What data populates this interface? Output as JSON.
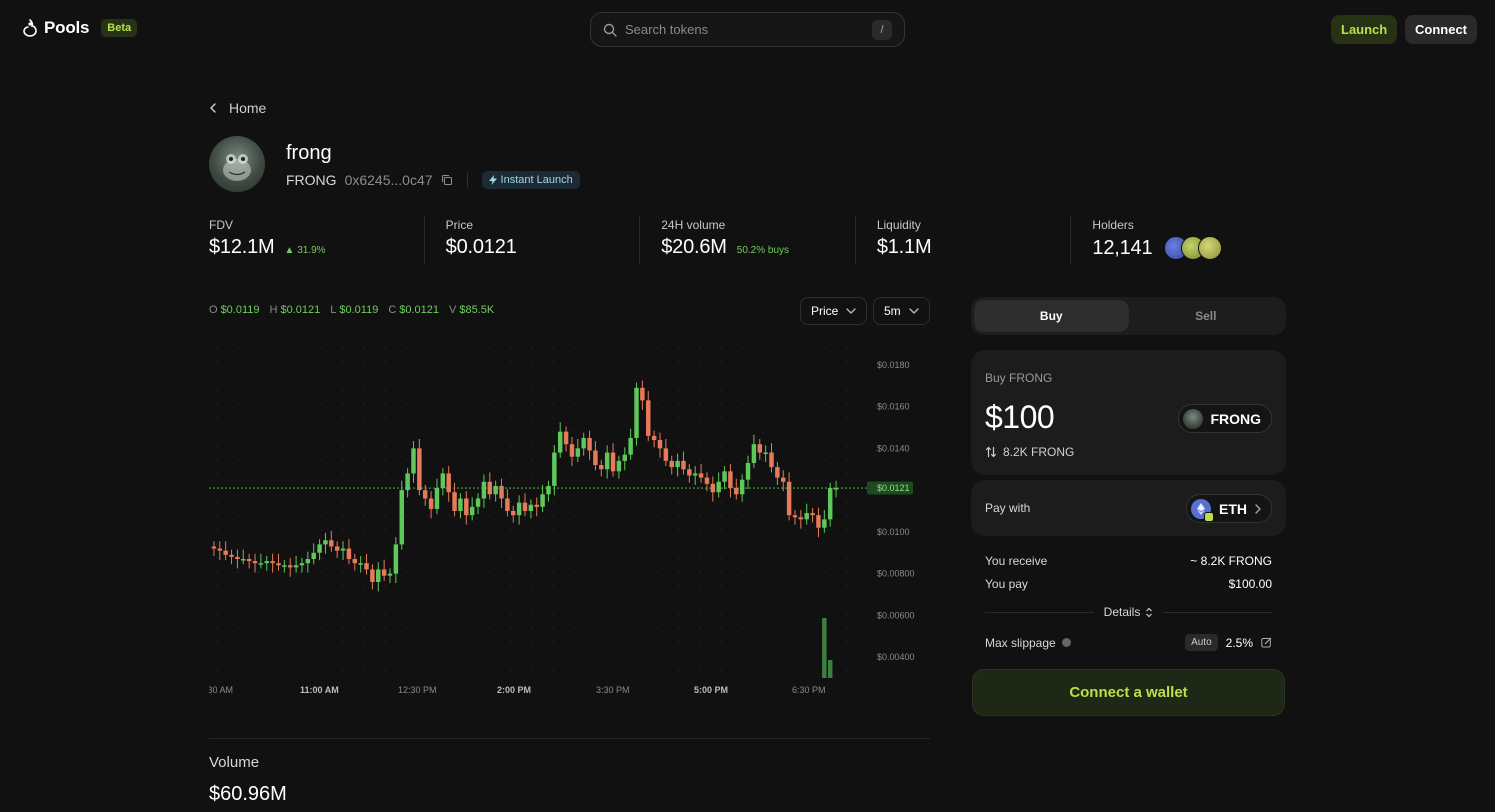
{
  "nav": {
    "logo_text": "Pools",
    "beta_label": "Beta",
    "search_placeholder": "Search tokens",
    "search_shortcut": "/",
    "launch_label": "Launch",
    "connect_label": "Connect"
  },
  "breadcrumb": {
    "back_label": "Home"
  },
  "token": {
    "name": "frong",
    "symbol": "FRONG",
    "address": "0x6245...0c47",
    "badge_label": "Instant Launch"
  },
  "stats": {
    "fdv": {
      "label": "FDV",
      "value": "$12.1M",
      "change": "31.9%"
    },
    "price": {
      "label": "Price",
      "value": "$0.0121"
    },
    "volume_24h": {
      "label": "24H volume",
      "value": "$20.6M",
      "sub": "50.2% buys"
    },
    "liquidity": {
      "label": "Liquidity",
      "value": "$1.1M"
    },
    "holders": {
      "label": "Holders",
      "value": "12,141"
    }
  },
  "ohlc": {
    "o_label": "O",
    "o": "$0.0119",
    "h_label": "H",
    "h": "$0.0121",
    "l_label": "L",
    "l": "$0.0119",
    "c_label": "C",
    "c": "$0.0121",
    "v_label": "V",
    "v": "$85.5K"
  },
  "chart_controls": {
    "type_value": "Price",
    "interval_value": "5m"
  },
  "chart_data": {
    "type": "candlestick",
    "title": "",
    "y_ticks": [
      "$0.0180",
      "$0.0160",
      "$0.0140",
      "$0.0120",
      "$0.0100",
      "$0.00800",
      "$0.00600",
      "$0.00400"
    ],
    "x_ticks": [
      ":30 AM",
      "11:00 AM",
      "12:30 PM",
      "2:00 PM",
      "3:30 PM",
      "5:00 PM",
      "6:30 PM"
    ],
    "x_ticks_bold": [
      false,
      true,
      false,
      true,
      false,
      true,
      false
    ],
    "current_price_label": "$0.0121",
    "current_price": 0.0121,
    "ylim": [
      0.003,
      0.019
    ],
    "colors": {
      "up": "#5fc85a",
      "down": "#e87a5a",
      "grid": "#2a2a2a",
      "current": "#5fc85a"
    },
    "closes": [
      0.0092,
      0.0091,
      0.0089,
      0.0088,
      0.0087,
      0.0087,
      0.0086,
      0.0085,
      0.0085,
      0.0086,
      0.0085,
      0.0084,
      0.0084,
      0.0083,
      0.0084,
      0.0085,
      0.0087,
      0.009,
      0.0094,
      0.0096,
      0.0093,
      0.0091,
      0.0092,
      0.0087,
      0.0085,
      0.0085,
      0.0082,
      0.0076,
      0.0082,
      0.0079,
      0.008,
      0.0094,
      0.012,
      0.0128,
      0.014,
      0.012,
      0.0116,
      0.0111,
      0.0121,
      0.0128,
      0.0119,
      0.011,
      0.0116,
      0.0108,
      0.0112,
      0.0116,
      0.0124,
      0.0118,
      0.0122,
      0.0116,
      0.011,
      0.0108,
      0.0114,
      0.011,
      0.0113,
      0.0112,
      0.0118,
      0.0122,
      0.0138,
      0.0148,
      0.0142,
      0.0136,
      0.014,
      0.0145,
      0.0139,
      0.0132,
      0.013,
      0.0138,
      0.0129,
      0.0134,
      0.0137,
      0.0145,
      0.0169,
      0.0163,
      0.0146,
      0.0144,
      0.014,
      0.0134,
      0.0131,
      0.0134,
      0.013,
      0.0127,
      0.0128,
      0.0126,
      0.0123,
      0.0119,
      0.0124,
      0.0129,
      0.0121,
      0.0118,
      0.0125,
      0.0133,
      0.0142,
      0.0138,
      0.0138,
      0.0131,
      0.0126,
      0.0124,
      0.0108,
      0.0107,
      0.0106,
      0.0109,
      0.0108,
      0.0102,
      0.0106,
      0.0121,
      0.0121
    ],
    "volumes": [
      0,
      0,
      0,
      0,
      0,
      0,
      0,
      0,
      0,
      0,
      0,
      0,
      0,
      0,
      0,
      0,
      0,
      0,
      0,
      0,
      0,
      0,
      0,
      0,
      0,
      0,
      0,
      0,
      0,
      0,
      0,
      0,
      0,
      0,
      0,
      0,
      0,
      0,
      0,
      0,
      0,
      0,
      0,
      0,
      0,
      0,
      0,
      0,
      0,
      0,
      0,
      0,
      0,
      0,
      0,
      0,
      0,
      0,
      0,
      0,
      0,
      0,
      0,
      0,
      0,
      0,
      0,
      0,
      0,
      0,
      0,
      0,
      0,
      0,
      0,
      0,
      0,
      0,
      0,
      0,
      0,
      0,
      0,
      0,
      0,
      0,
      0,
      0,
      0,
      0,
      0,
      0,
      0,
      0,
      0,
      0,
      0,
      0,
      0,
      0,
      0,
      0,
      0,
      0,
      1.0,
      0.3
    ]
  },
  "volume_section": {
    "label": "Volume",
    "value": "$60.96M"
  },
  "trade": {
    "buy_tab": "Buy",
    "sell_tab": "Sell",
    "buy_title": "Buy FRONG",
    "amount": "$100",
    "token_pill": "FRONG",
    "conversion": "8.2K FRONG",
    "pay_label": "Pay with",
    "pay_token": "ETH",
    "receive_label": "You receive",
    "receive_value": "~ 8.2K FRONG",
    "pay_value_label": "You pay",
    "pay_value": "$100.00",
    "details_label": "Details",
    "slippage_label": "Max slippage",
    "slippage_mode": "Auto",
    "slippage_value": "2.5%",
    "connect_wallet": "Connect a wallet"
  },
  "colors": {
    "accent": "#b8e04a",
    "positive": "#6fce5c",
    "negative": "#e87a5a",
    "background": "#111111"
  }
}
